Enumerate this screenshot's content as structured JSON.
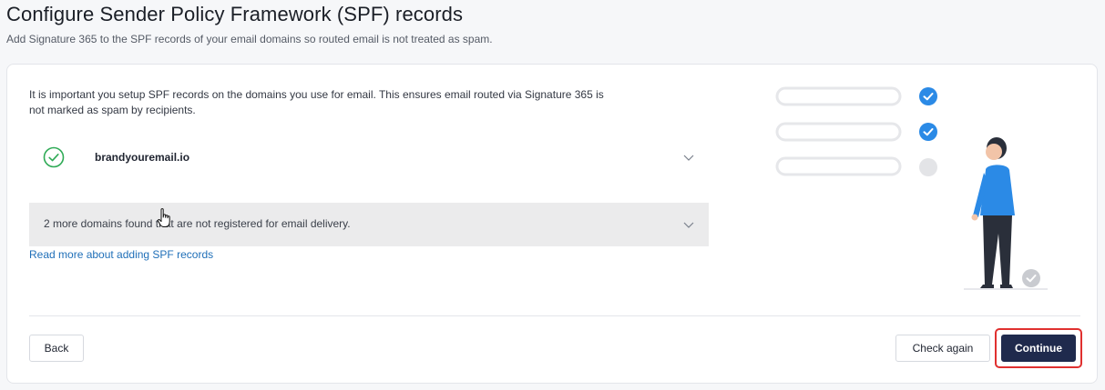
{
  "header": {
    "title": "Configure Sender Policy Framework (SPF) records",
    "subtitle": "Add Signature 365 to the SPF records of your email domains so routed email is not treated as spam."
  },
  "card": {
    "intro": "It is important you setup SPF records on the domains you use for email. This ensures email routed via Signature 365 is not marked as spam by recipients.",
    "domains": [
      {
        "name": "brandyouremail.io",
        "status": "verified",
        "icon": "check-circle-icon"
      }
    ],
    "more_domains_text": "2 more domains found that are not registered for email delivery.",
    "read_more_link": "Read more about adding SPF records"
  },
  "footer": {
    "back_label": "Back",
    "check_again_label": "Check again",
    "continue_label": "Continue"
  },
  "colors": {
    "accent": "#1f2a4d",
    "success": "#2eaa55",
    "link": "#1f6fb8",
    "check_blue": "#2b8ae6",
    "highlight": "#e0302f"
  }
}
